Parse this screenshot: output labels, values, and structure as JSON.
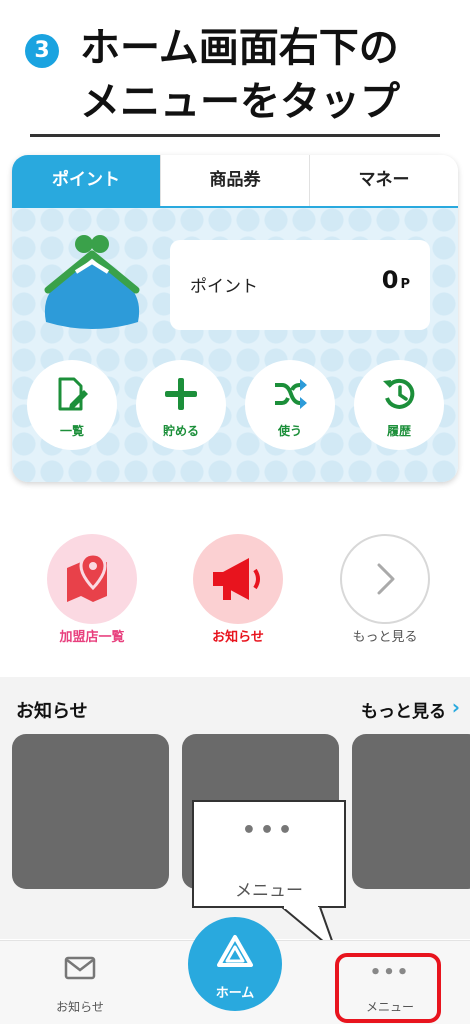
{
  "instruction": {
    "step_number": "3",
    "line1": "ホーム画面右下の",
    "line2": "メニューをタップ"
  },
  "card": {
    "tabs": [
      {
        "label": "ポイント",
        "active": true
      },
      {
        "label": "商品券",
        "active": false
      },
      {
        "label": "マネー",
        "active": false
      }
    ],
    "points_label": "ポイント",
    "points_value": "0",
    "points_unit": "P",
    "actions": [
      {
        "label": "一覧",
        "icon": "document-edit-icon"
      },
      {
        "label": "貯める",
        "icon": "plus-icon"
      },
      {
        "label": "使う",
        "icon": "shuffle-icon"
      },
      {
        "label": "履歴",
        "icon": "history-icon"
      }
    ]
  },
  "quick_links": [
    {
      "label": "加盟店一覧",
      "icon": "map-pin-icon",
      "color": "#e8407e"
    },
    {
      "label": "お知らせ",
      "icon": "megaphone-icon",
      "color": "#e8141e"
    },
    {
      "label": "もっと見る",
      "icon": "chevron-right-icon",
      "color": "#555555"
    }
  ],
  "news": {
    "title": "お知らせ",
    "more_label": "もっと見る",
    "more_chevron": "›"
  },
  "callout": {
    "dots": "•••",
    "label": "メニュー"
  },
  "bottom_nav": {
    "mail_label": "お知らせ",
    "home_label": "ホーム",
    "menu_dots": "•••",
    "menu_label": "メニュー"
  },
  "colors": {
    "accent_blue": "#29a9de",
    "action_green": "#1c8f3a",
    "highlight_red": "#e8141e"
  }
}
